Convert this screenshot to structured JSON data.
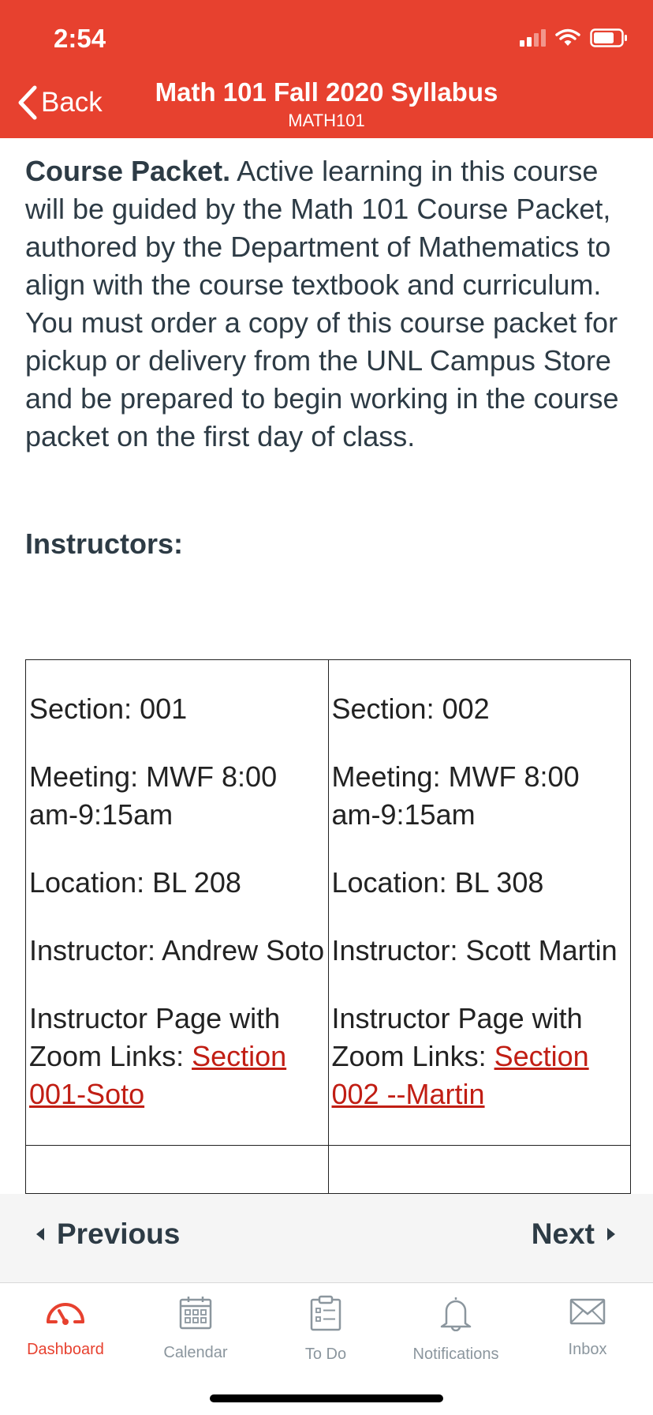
{
  "status_bar": {
    "time": "2:54"
  },
  "nav": {
    "back_label": "Back",
    "title": "Math 101 Fall 2020 Syllabus",
    "subtitle": "MATH101"
  },
  "content": {
    "packet_heading": "Course Packet.",
    "packet_text": " Active learning in this course will be guided by the Math 101 Course Packet, authored by the Department of Mathematics to align with the course textbook and curriculum. You must order a copy of this course packet for pickup or delivery from the UNL Campus Store and be prepared to begin working in the course packet on the first day of class.",
    "instructors_heading": "Instructors:",
    "sections": [
      {
        "section": "Section: 001",
        "meeting": "Meeting: MWF  8:00 am-9:15am",
        "location": "Location: BL 208",
        "instructor": "Instructor: Andrew Soto",
        "zoom_prefix": "Instructor Page with Zoom Links: ",
        "zoom_link": "Section 001-Soto"
      },
      {
        "section": "Section: 002",
        "meeting": "Meeting: MWF  8:00 am-9:15am",
        "location": "Location: BL 308",
        "instructor": "Instructor: Scott Martin",
        "zoom_prefix": "Instructor Page with Zoom Links: ",
        "zoom_link": "Section 002 --Martin"
      }
    ]
  },
  "pager": {
    "previous": "Previous",
    "next": "Next"
  },
  "tabs": [
    {
      "label": "Dashboard",
      "icon": "dashboard-icon",
      "active": true
    },
    {
      "label": "Calendar",
      "icon": "calendar-icon",
      "active": false
    },
    {
      "label": "To Do",
      "icon": "todo-icon",
      "active": false
    },
    {
      "label": "Notifications",
      "icon": "bell-icon",
      "active": false
    },
    {
      "label": "Inbox",
      "icon": "inbox-icon",
      "active": false
    }
  ],
  "colors": {
    "brand": "#e7412f",
    "link": "#c11e14",
    "text": "#2d3b45",
    "tab_inactive": "#8b969e"
  }
}
